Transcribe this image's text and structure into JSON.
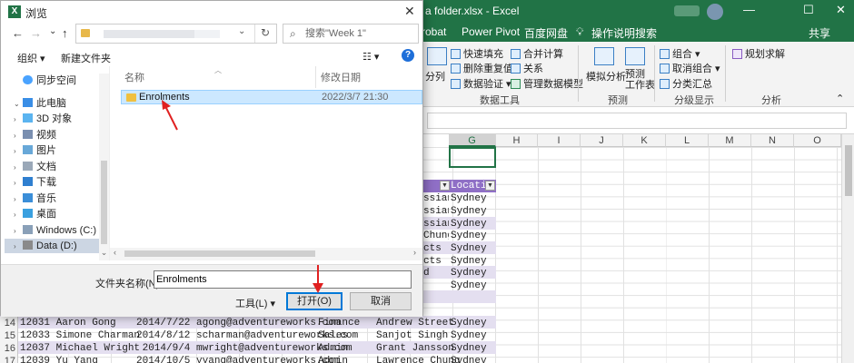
{
  "excel": {
    "title": "n a folder.xlsx  -  Excel",
    "window_controls": [
      "—",
      "☐",
      "✕"
    ],
    "tabs": [
      "crobat",
      "Power Pivot",
      "百度网盘",
      "操作说明搜索",
      "共享"
    ],
    "ribbon": {
      "data_tools": [
        "快速填充",
        "删除重复值",
        "数据验证",
        "合并计算",
        "关系",
        "管理数据模型"
      ],
      "split_label": "分列",
      "forecast": [
        "模拟分析",
        "预测\n工作表"
      ],
      "outline": [
        "组合",
        "取消组合",
        "分类汇总"
      ],
      "analysis": [
        "规划求解"
      ],
      "groups": [
        "数据工具",
        "预测",
        "分级显示",
        "分析"
      ]
    },
    "columns": [
      "G",
      "H",
      "I",
      "J",
      "K",
      "L",
      "M",
      "N",
      "O"
    ],
    "table_header": "Locati",
    "col_f_partial": [
      "ssian",
      "ssian",
      "ssian",
      "Chung",
      "cts",
      "cts",
      "d"
    ],
    "col_g_values": [
      "Sydney",
      "Sydney",
      "Sydney",
      "Sydney",
      "Sydney",
      "Sydney",
      "Sydney",
      "Sydney"
    ],
    "rows": [
      {
        "num": "14",
        "a": "12031 Aaron Gong",
        "b": "2014/7/22 agong@adventureworks.com",
        "c": "Finance",
        "d": "Andrew Street",
        "e": "Sydney"
      },
      {
        "num": "15",
        "a": "12033 Simone Charman",
        "b": "2014/8/12 scharman@adventureworks.com",
        "c": "Sales",
        "d": "Sanjot Singh",
        "e": "Sydney"
      },
      {
        "num": "16",
        "a": "12037 Michael Wright",
        "b": " 2014/9/4 mwright@adventureworks.com",
        "c": "Admin",
        "d": "Grant Jansson",
        "e": "Sydney"
      },
      {
        "num": "17",
        "a": "12039 Yu Yang",
        "b": "2014/10/5 yyang@adventureworks.com",
        "c": "Admin",
        "d": "Lawrence Chung",
        "e": "Sydney"
      }
    ]
  },
  "dialog": {
    "title": "浏览",
    "close": "✕",
    "nav": {
      "back": "←",
      "forward": "→",
      "dropdown": "⌄",
      "up": "↑"
    },
    "search_placeholder": "搜索\"Week 1\"",
    "toolbar": {
      "organize": "组织 ▾",
      "new_folder": "新建文件夹",
      "view": "☷ ▾",
      "help": "?"
    },
    "nav_items": [
      {
        "label": "同步空间",
        "icon": "cloud-icon"
      },
      {
        "label": "此电脑",
        "icon": "computer-icon"
      },
      {
        "label": "3D 对象",
        "icon": "cube-icon"
      },
      {
        "label": "视频",
        "icon": "video-icon"
      },
      {
        "label": "图片",
        "icon": "picture-icon"
      },
      {
        "label": "文档",
        "icon": "document-icon"
      },
      {
        "label": "下载",
        "icon": "download-icon"
      },
      {
        "label": "音乐",
        "icon": "music-icon"
      },
      {
        "label": "桌面",
        "icon": "desktop-icon"
      },
      {
        "label": "Windows (C:)",
        "icon": "drive-icon"
      },
      {
        "label": "Data (D:)",
        "icon": "drive-icon"
      }
    ],
    "columns": {
      "name": "名称",
      "modified": "修改日期"
    },
    "files": [
      {
        "name": "Enrolments",
        "modified": "2022/3/7 21:30"
      }
    ],
    "folder_label": "文件夹名称(N):",
    "folder_value": "Enrolments",
    "tools_label": "工具(L)  ▾",
    "open_label": "打开(O)",
    "cancel_label": "取消"
  },
  "colors": {
    "excel_green": "#217346",
    "selection_blue": "#cce8ff",
    "annotation_red": "#e02020",
    "table_purple": "#8f6fc6"
  }
}
